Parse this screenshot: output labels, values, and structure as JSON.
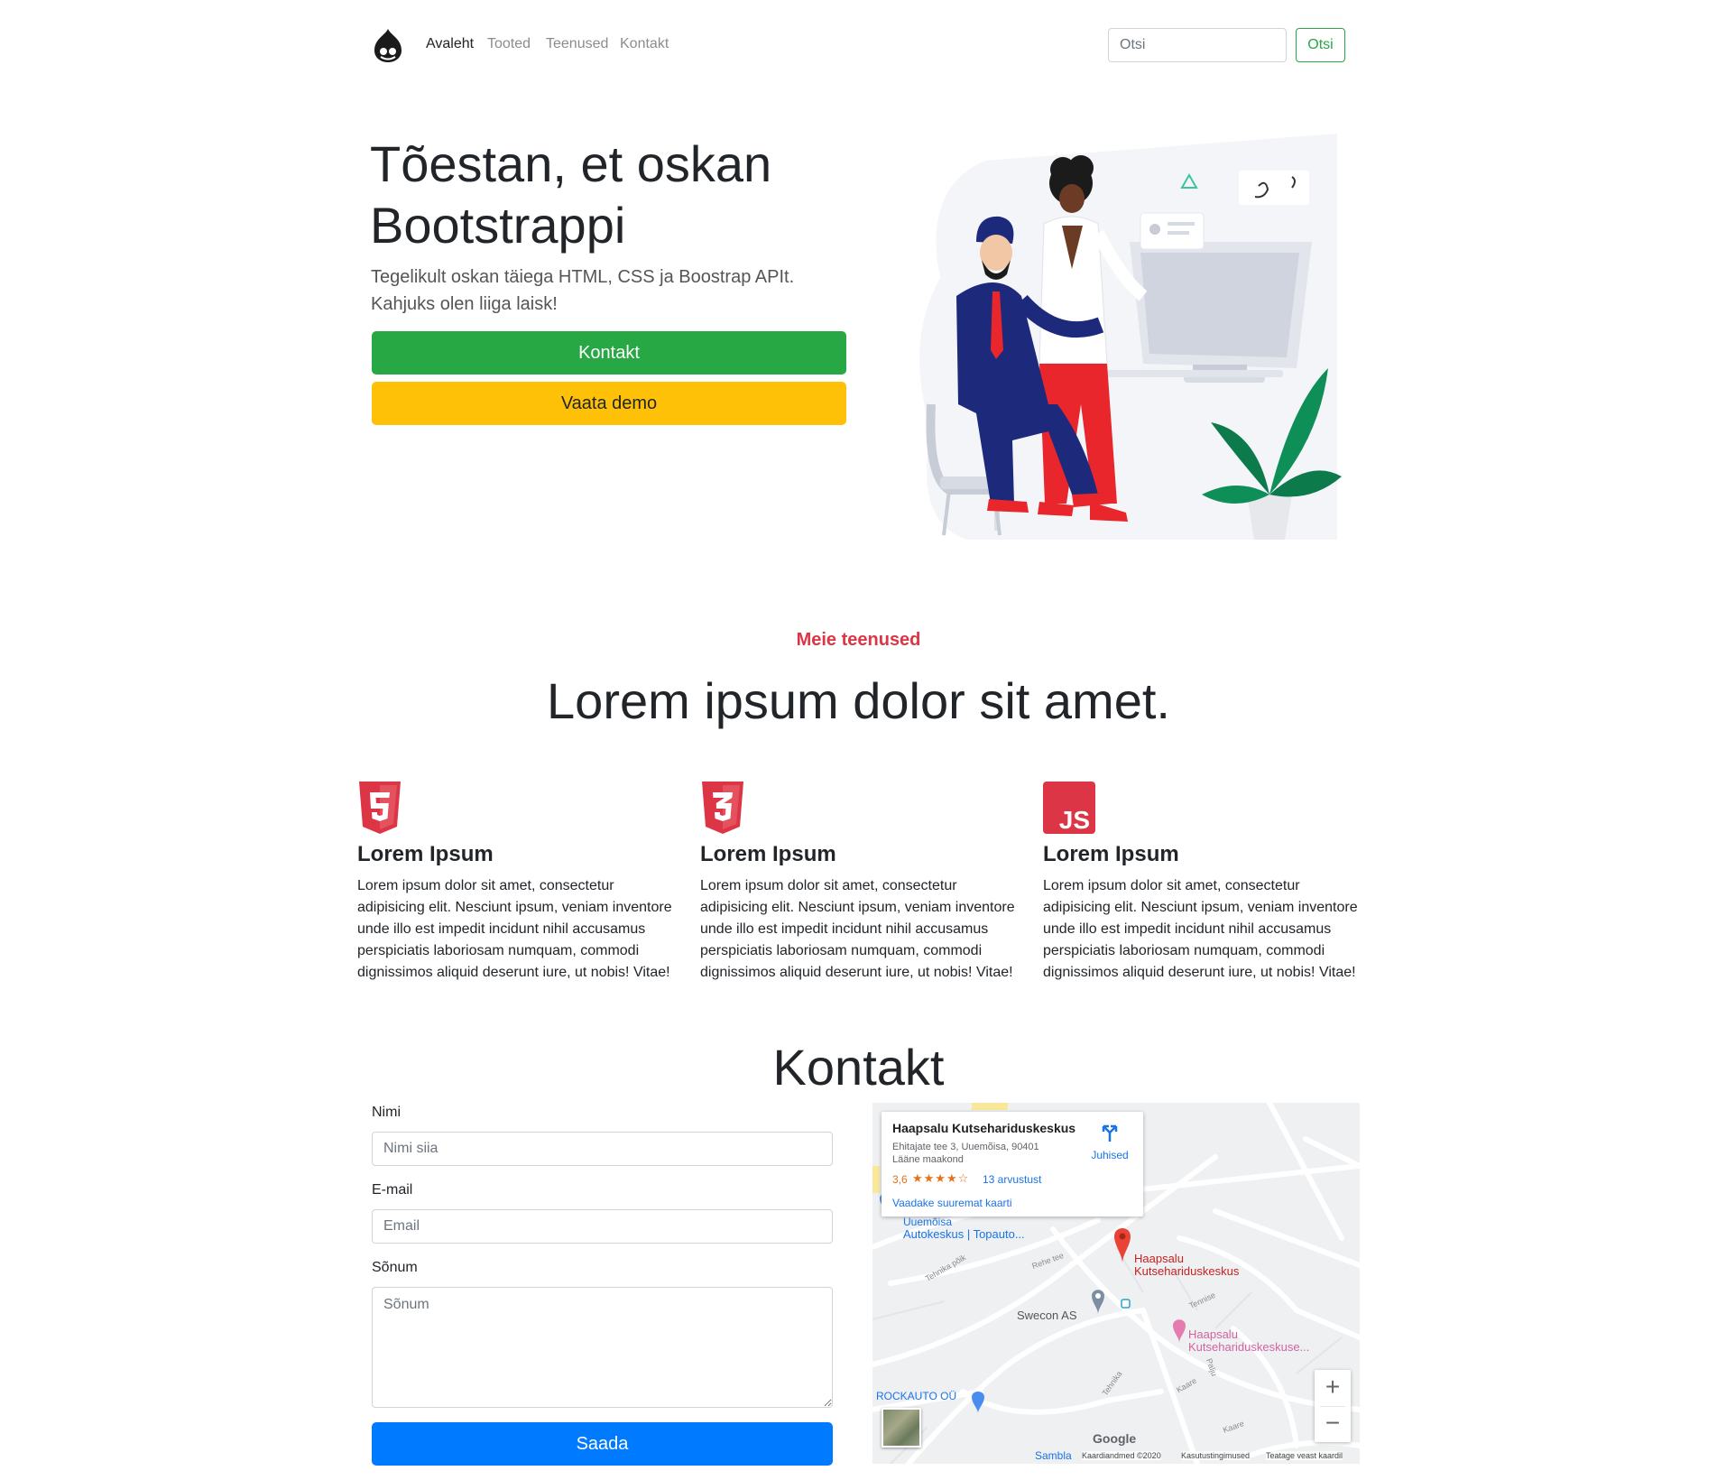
{
  "nav": {
    "links": [
      "Avaleht",
      "Tooted",
      "Teenused",
      "Kontakt"
    ],
    "search_placeholder": "Otsi",
    "search_button": "Otsi"
  },
  "hero": {
    "title": "Tõestan, et oskan Bootstrappi",
    "subtitle": "Tegelikult oskan täiega HTML, CSS ja Boostrap APIt. Kahjuks olen liiga laisk!",
    "primary_button": "Kontakt",
    "secondary_button": "Vaata demo"
  },
  "services": {
    "eyebrow": "Meie teenused",
    "title": "Lorem ipsum dolor sit amet.",
    "features": [
      {
        "icon": "html5-icon",
        "title": "Lorem Ipsum",
        "text": "Lorem ipsum dolor sit amet, consectetur adipisicing elit. Nesciunt ipsum, veniam inventore unde illo est impedit incidunt nihil accusamus perspiciatis laboriosam numquam, commodi dignissimos aliquid deserunt iure, ut nobis! Vitae!"
      },
      {
        "icon": "css3-icon",
        "title": "Lorem Ipsum",
        "text": "Lorem ipsum dolor sit amet, consectetur adipisicing elit. Nesciunt ipsum, veniam inventore unde illo est impedit incidunt nihil accusamus perspiciatis laboriosam numquam, commodi dignissimos aliquid deserunt iure, ut nobis! Vitae!"
      },
      {
        "icon": "javascript-icon",
        "title": "Lorem Ipsum",
        "text": "Lorem ipsum dolor sit amet, consectetur adipisicing elit. Nesciunt ipsum, veniam inventore unde illo est impedit incidunt nihil accusamus perspiciatis laboriosam numquam, commodi dignissimos aliquid deserunt iure, ut nobis! Vitae!"
      }
    ]
  },
  "contact": {
    "title": "Kontakt",
    "name_label": "Nimi",
    "name_placeholder": "Nimi siia",
    "email_label": "E-mail",
    "email_placeholder": "Email",
    "message_label": "Sõnum",
    "message_placeholder": "Sõnum",
    "submit": "Saada"
  },
  "map": {
    "place_name": "Haapsalu Kutsehariduskeskus",
    "address_line1": "Ehitajate tee 3, Uuemõisa, 90401",
    "address_line2": "Lääne maakond",
    "rating": "3,6",
    "stars": "★★★★☆",
    "reviews": "13 arvustust",
    "directions": "Juhised",
    "larger_map": "Vaadake suuremat kaarti",
    "pin_label_1": "Haapsalu",
    "pin_label_2": "Kutsehariduskeskus",
    "poi_autokeskus_top": "Uuemõisa",
    "poi_autokeskus": "Autokeskus | Topauto...",
    "poi_swecon": "Swecon AS",
    "poi_hkk2_1": "Haapsalu",
    "poi_hkk2_2": "Kutsehariduskeskuse...",
    "poi_rockauto": "ROCKAUTO OÜ",
    "streets": [
      "Tehnika põik",
      "Rehe tee",
      "Tennise",
      "Palju",
      "Kaare",
      "Tehnika",
      "Kaare"
    ],
    "footer_sambla": "Sambla",
    "footer_google": "Google",
    "footer_data": "Kaardiandmed ©2020",
    "footer_terms": "Kasutustingimused",
    "footer_report": "Teatage veast kaardil",
    "zoom_in": "+",
    "zoom_out": "−"
  },
  "colors": {
    "green": "#28a745",
    "yellow": "#ffc107",
    "red": "#dc3545",
    "blue": "#007bff"
  }
}
